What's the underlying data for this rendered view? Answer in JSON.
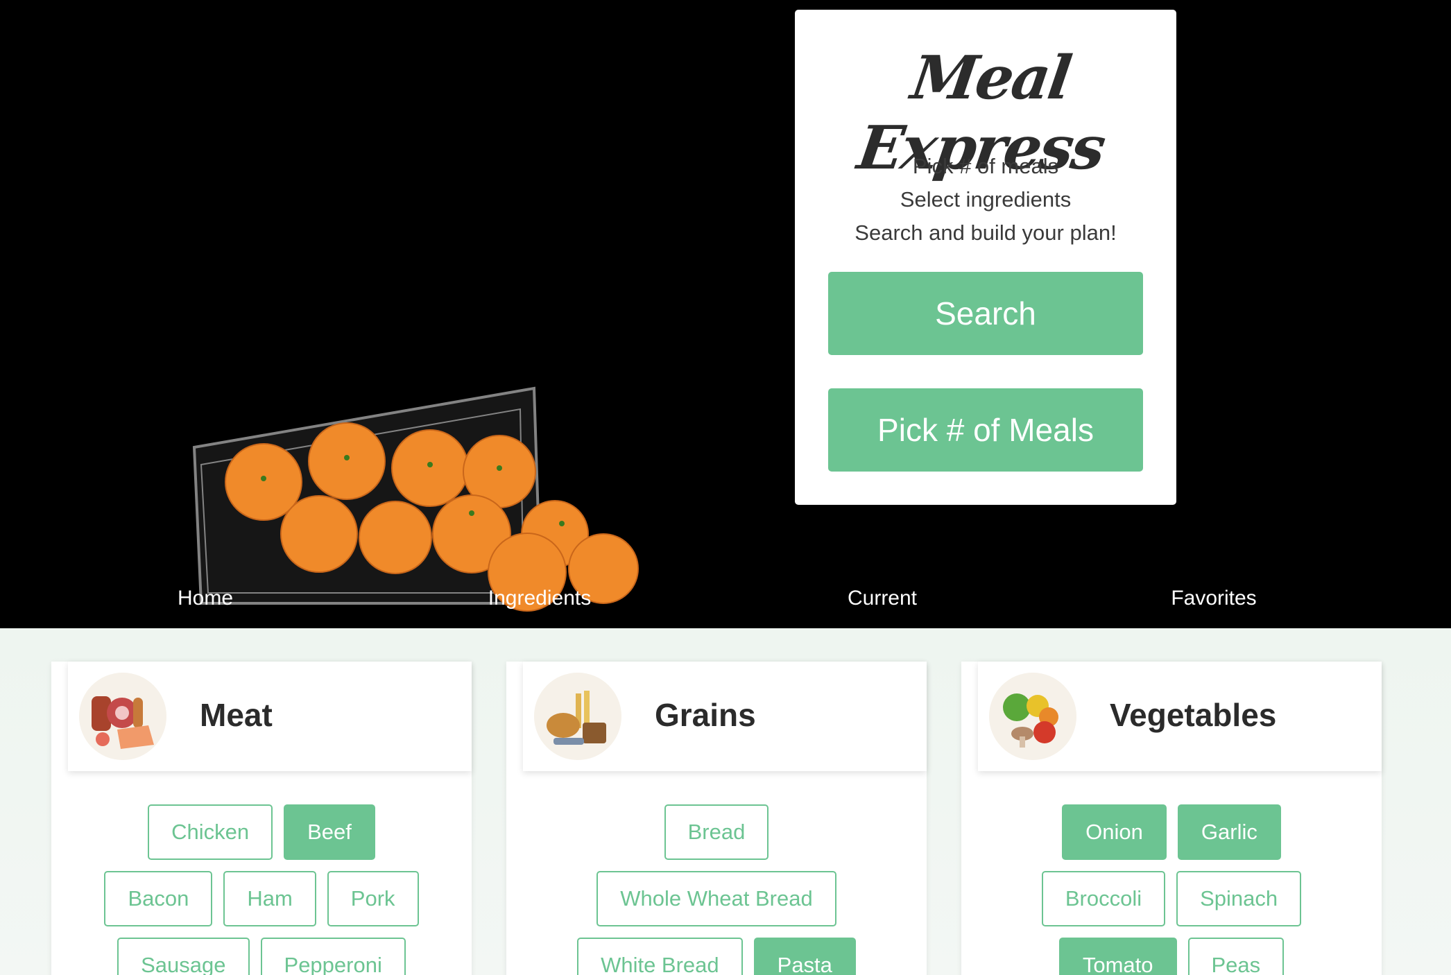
{
  "hero": {
    "brand": "Meal Express",
    "tagline": [
      "Pick # of meals",
      "Select ingredients",
      "Search and build your plan!"
    ],
    "search_label": "Search",
    "pick_meals_label": "Pick # of Meals"
  },
  "nav": {
    "items": [
      "Home",
      "Ingredients",
      "Current",
      "Favorites"
    ]
  },
  "colors": {
    "accent": "#6cc492",
    "hero_bg": "#000000",
    "content_bg": "#eef5f0"
  },
  "categories": [
    {
      "title": "Meat",
      "icon": "meat-icon",
      "rows": [
        [
          {
            "label": "Chicken",
            "selected": false
          },
          {
            "label": "Beef",
            "selected": true
          }
        ],
        [
          {
            "label": "Bacon",
            "selected": false
          },
          {
            "label": "Ham",
            "selected": false
          },
          {
            "label": "Pork",
            "selected": false
          }
        ],
        [
          {
            "label": "Sausage",
            "selected": false
          },
          {
            "label": "Pepperoni",
            "selected": false
          }
        ]
      ]
    },
    {
      "title": "Grains",
      "icon": "bread-icon",
      "rows": [
        [
          {
            "label": "Bread",
            "selected": false
          }
        ],
        [
          {
            "label": "Whole Wheat Bread",
            "selected": false
          }
        ],
        [
          {
            "label": "White Bread",
            "selected": false
          },
          {
            "label": "Pasta",
            "selected": true
          }
        ]
      ]
    },
    {
      "title": "Vegetables",
      "icon": "vegetables-icon",
      "rows": [
        [
          {
            "label": "Onion",
            "selected": true
          },
          {
            "label": "Garlic",
            "selected": true
          }
        ],
        [
          {
            "label": "Broccoli",
            "selected": false
          },
          {
            "label": "Spinach",
            "selected": false
          }
        ],
        [
          {
            "label": "Tomato",
            "selected": true
          },
          {
            "label": "Peas",
            "selected": false
          }
        ]
      ]
    }
  ]
}
